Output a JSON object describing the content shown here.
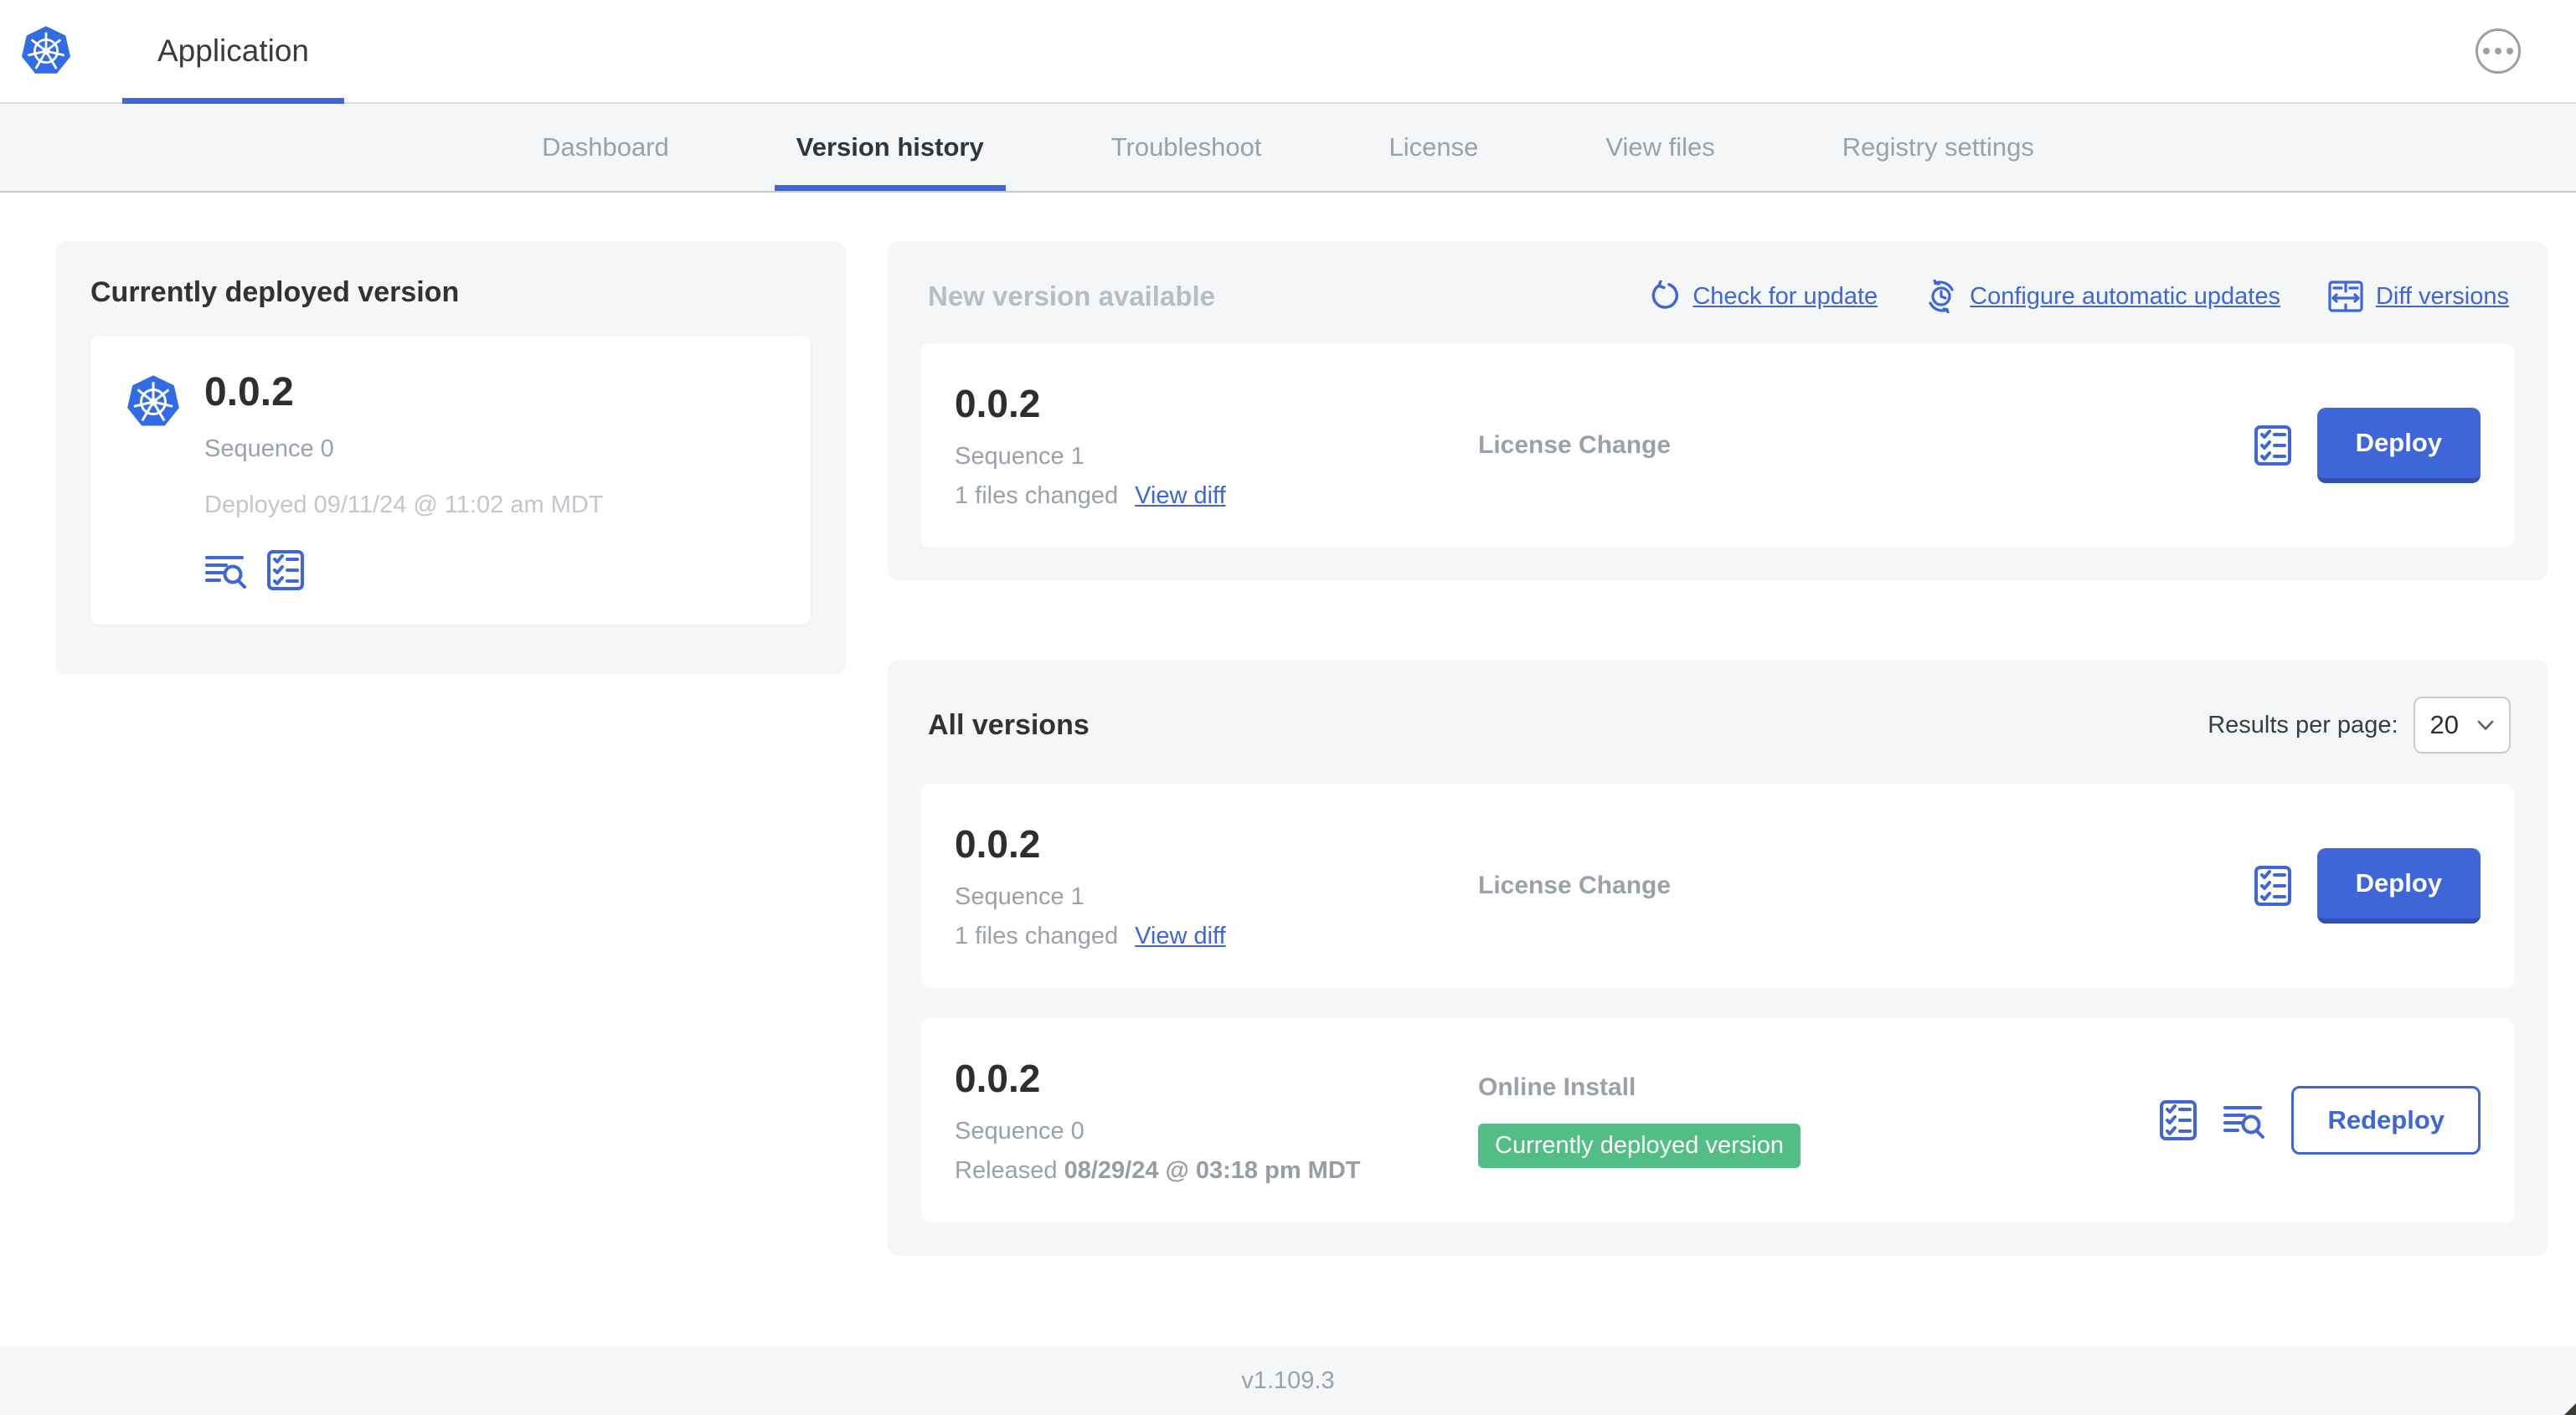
{
  "header": {
    "app_title": "Application",
    "menu_icon": "ellipsis-circle-icon"
  },
  "nav": {
    "tabs": [
      {
        "label": "Dashboard",
        "active": false
      },
      {
        "label": "Version history",
        "active": true
      },
      {
        "label": "Troubleshoot",
        "active": false
      },
      {
        "label": "License",
        "active": false
      },
      {
        "label": "View files",
        "active": false
      },
      {
        "label": "Registry settings",
        "active": false
      }
    ]
  },
  "current_version_card": {
    "title": "Currently deployed version",
    "version": "0.0.2",
    "sequence": "Sequence 0",
    "deployed": "Deployed 09/11/24 @ 11:02 am MDT",
    "icons": [
      "logs-icon",
      "checklist-icon"
    ]
  },
  "new_version_card": {
    "title": "New version available",
    "actions": {
      "check_for_update": "Check for update",
      "configure_automatic_updates": "Configure automatic updates",
      "diff_versions": "Diff versions"
    },
    "row": {
      "version": "0.0.2",
      "sequence": "Sequence 1",
      "files_changed": "1 files changed",
      "view_diff": "View diff",
      "source": "License Change",
      "deploy_label": "Deploy"
    }
  },
  "all_versions_card": {
    "title": "All versions",
    "results_per_page_label": "Results per page:",
    "results_per_page_value": "20",
    "rows": [
      {
        "version": "0.0.2",
        "sequence": "Sequence 1",
        "files_changed": "1 files changed",
        "view_diff": "View diff",
        "source": "License Change",
        "action_label": "Deploy"
      },
      {
        "version": "0.0.2",
        "sequence": "Sequence 0",
        "released_prefix": "Released ",
        "released_date": "08/29/24 @ 03:18 pm MDT",
        "source": "Online Install",
        "badge": "Currently deployed version",
        "action_label": "Redeploy"
      }
    ]
  },
  "footer": {
    "app_version": "v1.109.3"
  },
  "icons": {
    "kubernetes-logo": "blue heptagon with white ship wheel",
    "ellipsis-circle-icon": "three dots in circle",
    "refresh-icon": "circular arrow",
    "clock-update-icon": "clock with circular arrows",
    "diff-icon": "split panes with left-right arrow",
    "checklist-icon": "clipboard with checkmarks",
    "logs-icon": "text lines with magnifier",
    "chevron-down-icon": "v chevron"
  },
  "colors": {
    "accent_blue": "#3e66d8",
    "k8s_blue": "#326ce5",
    "badge_green": "#52bd85",
    "panel_gray": "#f4f6f8",
    "muted_text": "#9aa1a9"
  }
}
